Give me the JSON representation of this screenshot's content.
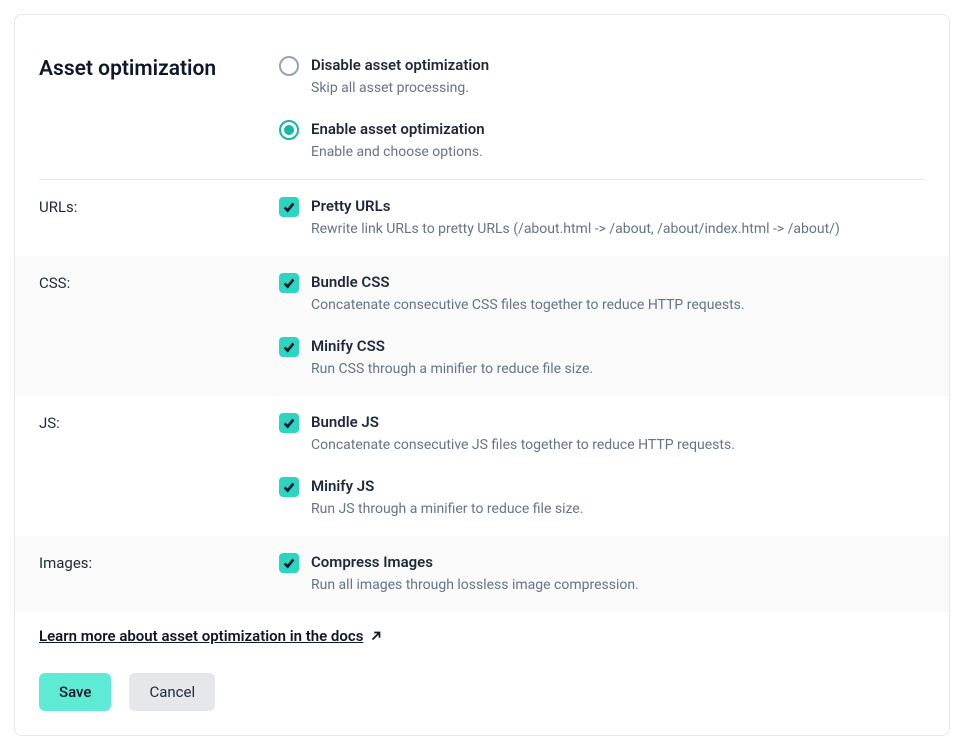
{
  "section_title": "Asset optimization",
  "radio_options": {
    "disable": {
      "label": "Disable asset optimization",
      "desc": "Skip all asset processing."
    },
    "enable": {
      "label": "Enable asset optimization",
      "desc": "Enable and choose options."
    }
  },
  "settings": {
    "urls": {
      "label": "URLs:",
      "items": [
        {
          "label": "Pretty URLs",
          "desc": "Rewrite link URLs to pretty URLs (/about.html -> /about, /about/index.html -> /about/)"
        }
      ]
    },
    "css": {
      "label": "CSS:",
      "items": [
        {
          "label": "Bundle CSS",
          "desc": "Concatenate consecutive CSS files together to reduce HTTP requests."
        },
        {
          "label": "Minify CSS",
          "desc": "Run CSS through a minifier to reduce file size."
        }
      ]
    },
    "js": {
      "label": "JS:",
      "items": [
        {
          "label": "Bundle JS",
          "desc": "Concatenate consecutive JS files together to reduce HTTP requests."
        },
        {
          "label": "Minify JS",
          "desc": "Run JS through a minifier to reduce file size."
        }
      ]
    },
    "images": {
      "label": "Images:",
      "items": [
        {
          "label": "Compress Images",
          "desc": "Run all images through lossless image compression."
        }
      ]
    }
  },
  "learn_link": "Learn more about asset optimization in the docs",
  "buttons": {
    "save": "Save",
    "cancel": "Cancel"
  }
}
